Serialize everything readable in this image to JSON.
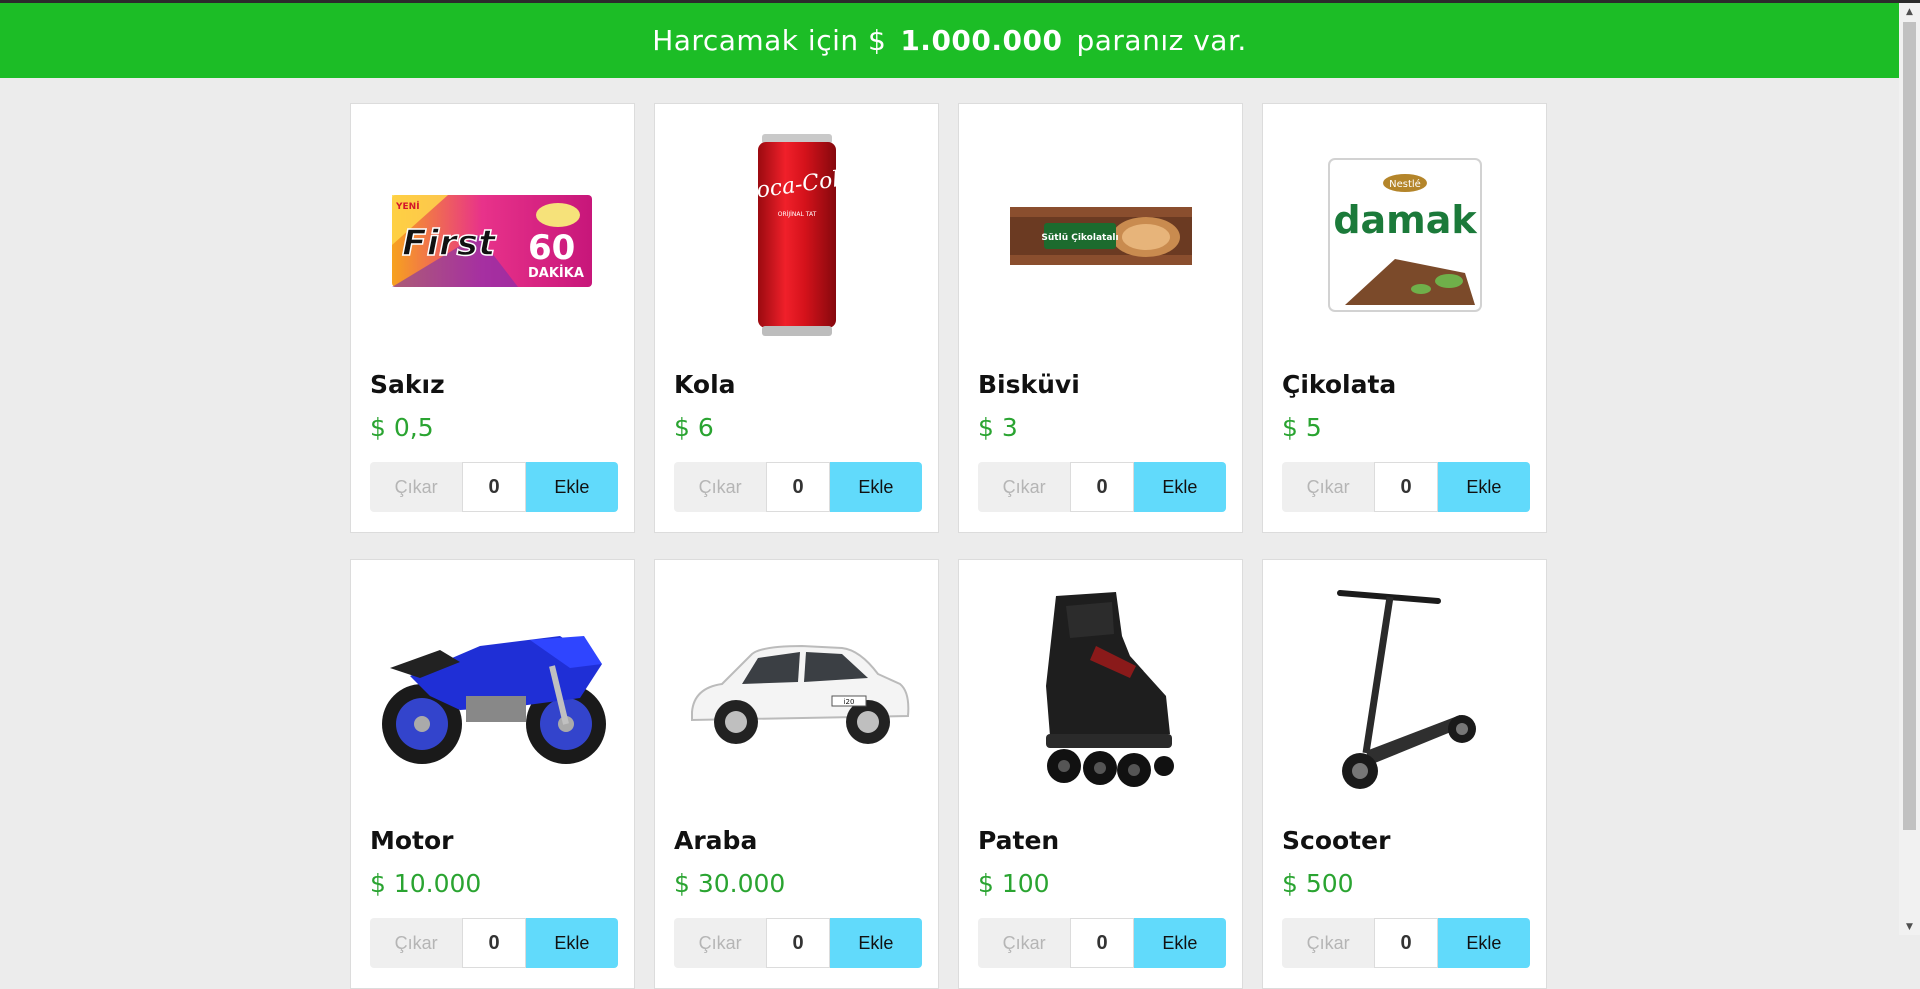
{
  "banner": {
    "prefix": "Harcamak için $",
    "amount": "1.000.000",
    "suffix": "paranız var."
  },
  "controls": {
    "remove_label": "Çıkar",
    "add_label": "Ekle"
  },
  "products": [
    {
      "name": "Sakız",
      "price": "$ 0,5",
      "qty": "0",
      "image": "gum-pack"
    },
    {
      "name": "Kola",
      "price": "$ 6",
      "qty": "0",
      "image": "cola-can"
    },
    {
      "name": "Bisküvi",
      "price": "$ 3",
      "qty": "0",
      "image": "biscuit-pack"
    },
    {
      "name": "Çikolata",
      "price": "$ 5",
      "qty": "0",
      "image": "chocolate-bar"
    },
    {
      "name": "Motor",
      "price": "$ 10.000",
      "qty": "0",
      "image": "motorcycle"
    },
    {
      "name": "Araba",
      "price": "$ 30.000",
      "qty": "0",
      "image": "car"
    },
    {
      "name": "Paten",
      "price": "$ 100",
      "qty": "0",
      "image": "inline-skate"
    },
    {
      "name": "Scooter",
      "price": "$ 500",
      "qty": "0",
      "image": "scooter"
    }
  ],
  "image_text": {
    "gum_brand": "First",
    "gum_number": "60",
    "gum_sub": "DAKİKA",
    "gum_new": "YENİ",
    "cola_logo": "Coca-Cola",
    "cola_sub": "ORİJİNAL TAT",
    "biscuit_label": "Sütlü Çikolatalı",
    "choc_brand": "damak",
    "choc_maker": "Nestlé",
    "car_plate": "i20"
  },
  "colors": {
    "banner": "#1cbd26",
    "price": "#2aa431",
    "add_button": "#61dafb",
    "remove_button": "#efefef"
  }
}
